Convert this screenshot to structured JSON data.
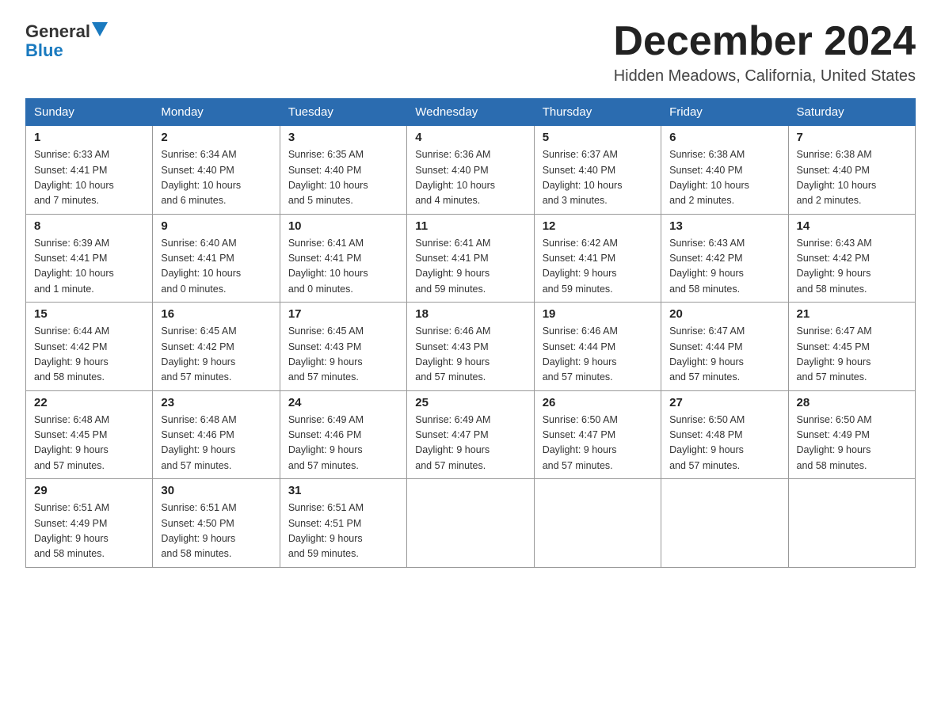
{
  "logo": {
    "line1": "General",
    "arrow": true,
    "line2": "Blue"
  },
  "title": "December 2024",
  "subtitle": "Hidden Meadows, California, United States",
  "days_of_week": [
    "Sunday",
    "Monday",
    "Tuesday",
    "Wednesday",
    "Thursday",
    "Friday",
    "Saturday"
  ],
  "weeks": [
    [
      {
        "day": "1",
        "sunrise": "6:33 AM",
        "sunset": "4:41 PM",
        "daylight": "10 hours and 7 minutes."
      },
      {
        "day": "2",
        "sunrise": "6:34 AM",
        "sunset": "4:40 PM",
        "daylight": "10 hours and 6 minutes."
      },
      {
        "day": "3",
        "sunrise": "6:35 AM",
        "sunset": "4:40 PM",
        "daylight": "10 hours and 5 minutes."
      },
      {
        "day": "4",
        "sunrise": "6:36 AM",
        "sunset": "4:40 PM",
        "daylight": "10 hours and 4 minutes."
      },
      {
        "day": "5",
        "sunrise": "6:37 AM",
        "sunset": "4:40 PM",
        "daylight": "10 hours and 3 minutes."
      },
      {
        "day": "6",
        "sunrise": "6:38 AM",
        "sunset": "4:40 PM",
        "daylight": "10 hours and 2 minutes."
      },
      {
        "day": "7",
        "sunrise": "6:38 AM",
        "sunset": "4:40 PM",
        "daylight": "10 hours and 2 minutes."
      }
    ],
    [
      {
        "day": "8",
        "sunrise": "6:39 AM",
        "sunset": "4:41 PM",
        "daylight": "10 hours and 1 minute."
      },
      {
        "day": "9",
        "sunrise": "6:40 AM",
        "sunset": "4:41 PM",
        "daylight": "10 hours and 0 minutes."
      },
      {
        "day": "10",
        "sunrise": "6:41 AM",
        "sunset": "4:41 PM",
        "daylight": "10 hours and 0 minutes."
      },
      {
        "day": "11",
        "sunrise": "6:41 AM",
        "sunset": "4:41 PM",
        "daylight": "9 hours and 59 minutes."
      },
      {
        "day": "12",
        "sunrise": "6:42 AM",
        "sunset": "4:41 PM",
        "daylight": "9 hours and 59 minutes."
      },
      {
        "day": "13",
        "sunrise": "6:43 AM",
        "sunset": "4:42 PM",
        "daylight": "9 hours and 58 minutes."
      },
      {
        "day": "14",
        "sunrise": "6:43 AM",
        "sunset": "4:42 PM",
        "daylight": "9 hours and 58 minutes."
      }
    ],
    [
      {
        "day": "15",
        "sunrise": "6:44 AM",
        "sunset": "4:42 PM",
        "daylight": "9 hours and 58 minutes."
      },
      {
        "day": "16",
        "sunrise": "6:45 AM",
        "sunset": "4:42 PM",
        "daylight": "9 hours and 57 minutes."
      },
      {
        "day": "17",
        "sunrise": "6:45 AM",
        "sunset": "4:43 PM",
        "daylight": "9 hours and 57 minutes."
      },
      {
        "day": "18",
        "sunrise": "6:46 AM",
        "sunset": "4:43 PM",
        "daylight": "9 hours and 57 minutes."
      },
      {
        "day": "19",
        "sunrise": "6:46 AM",
        "sunset": "4:44 PM",
        "daylight": "9 hours and 57 minutes."
      },
      {
        "day": "20",
        "sunrise": "6:47 AM",
        "sunset": "4:44 PM",
        "daylight": "9 hours and 57 minutes."
      },
      {
        "day": "21",
        "sunrise": "6:47 AM",
        "sunset": "4:45 PM",
        "daylight": "9 hours and 57 minutes."
      }
    ],
    [
      {
        "day": "22",
        "sunrise": "6:48 AM",
        "sunset": "4:45 PM",
        "daylight": "9 hours and 57 minutes."
      },
      {
        "day": "23",
        "sunrise": "6:48 AM",
        "sunset": "4:46 PM",
        "daylight": "9 hours and 57 minutes."
      },
      {
        "day": "24",
        "sunrise": "6:49 AM",
        "sunset": "4:46 PM",
        "daylight": "9 hours and 57 minutes."
      },
      {
        "day": "25",
        "sunrise": "6:49 AM",
        "sunset": "4:47 PM",
        "daylight": "9 hours and 57 minutes."
      },
      {
        "day": "26",
        "sunrise": "6:50 AM",
        "sunset": "4:47 PM",
        "daylight": "9 hours and 57 minutes."
      },
      {
        "day": "27",
        "sunrise": "6:50 AM",
        "sunset": "4:48 PM",
        "daylight": "9 hours and 57 minutes."
      },
      {
        "day": "28",
        "sunrise": "6:50 AM",
        "sunset": "4:49 PM",
        "daylight": "9 hours and 58 minutes."
      }
    ],
    [
      {
        "day": "29",
        "sunrise": "6:51 AM",
        "sunset": "4:49 PM",
        "daylight": "9 hours and 58 minutes."
      },
      {
        "day": "30",
        "sunrise": "6:51 AM",
        "sunset": "4:50 PM",
        "daylight": "9 hours and 58 minutes."
      },
      {
        "day": "31",
        "sunrise": "6:51 AM",
        "sunset": "4:51 PM",
        "daylight": "9 hours and 59 minutes."
      },
      null,
      null,
      null,
      null
    ]
  ],
  "labels": {
    "sunrise": "Sunrise:",
    "sunset": "Sunset:",
    "daylight": "Daylight:"
  }
}
